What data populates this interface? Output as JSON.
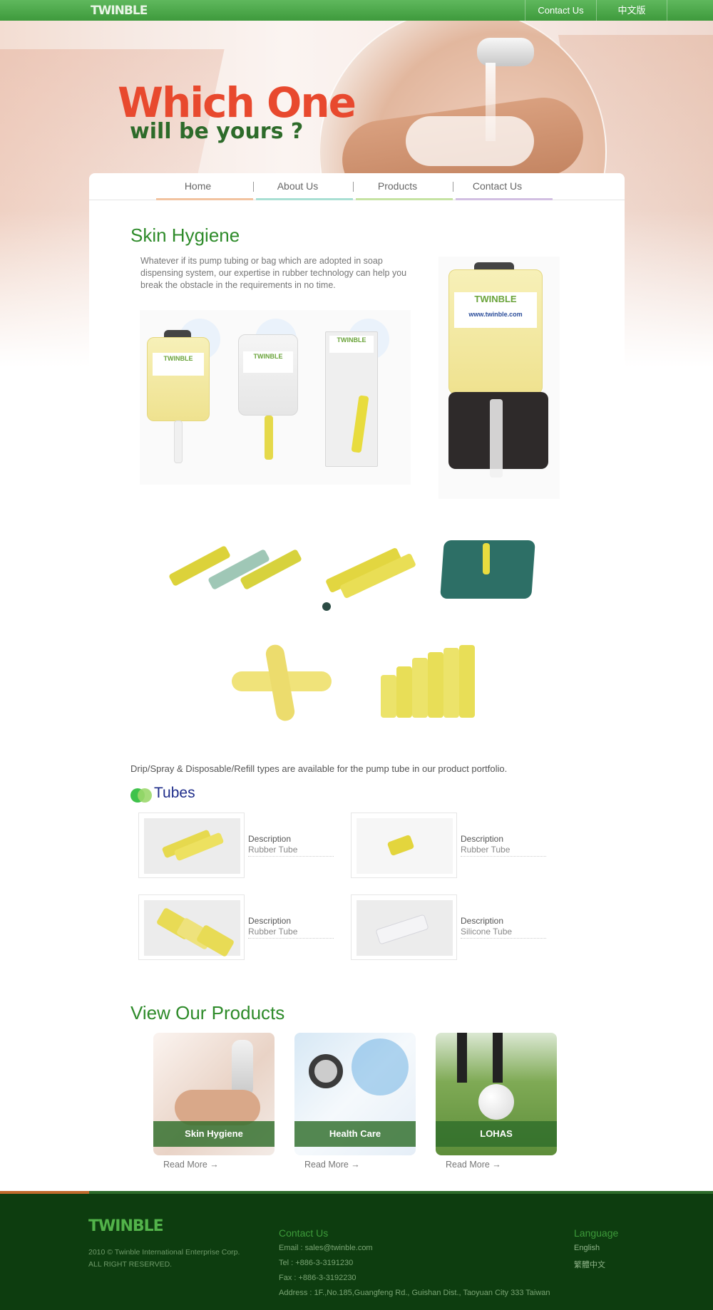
{
  "topbar": {
    "logo": "TWINBLE",
    "contact_label": "Contact Us",
    "chinese_label": "中文版"
  },
  "hero": {
    "title": "Which One",
    "subtitle": "will be yours ?"
  },
  "nav": {
    "items": [
      {
        "label": "Home",
        "color": "#f2c3a0"
      },
      {
        "label": "About Us",
        "color": "#a9dfd3"
      },
      {
        "label": "Products",
        "color": "#c6e3a3"
      },
      {
        "label": "Contact Us",
        "color": "#d2bfe2"
      }
    ]
  },
  "skin": {
    "title": "Skin Hygiene",
    "intro": "Whatever if its pump tubing or bag which are adopted in soap dispensing system, our expertise in rubber technology can help you break the obstacle in the requirements in no time.",
    "bottle_label": "TWINBLE",
    "bottle_url": "www.twinble.com"
  },
  "note": "Drip/Spray & Disposable/Refill types are available for the pump tube in our product portfolio.",
  "tubes": {
    "title": "Tubes",
    "items": [
      {
        "desc_title": "Description",
        "desc_value": "Rubber Tube"
      },
      {
        "desc_title": "Description",
        "desc_value": "Rubber Tube"
      },
      {
        "desc_title": "Description",
        "desc_value": "Rubber Tube"
      },
      {
        "desc_title": "Description",
        "desc_value": "Silicone Tube"
      }
    ]
  },
  "products": {
    "title": "View Our Products",
    "items": [
      {
        "label": "Skin Hygiene",
        "read_more": "Read More →"
      },
      {
        "label": "Health Care",
        "read_more": "Read More →"
      },
      {
        "label": "LOHAS",
        "read_more": "Read More →"
      }
    ]
  },
  "footer": {
    "logo": "TWINBLE",
    "copyright": "2010 © Twinble International Enterprise Corp.",
    "rights": "ALL RIGHT RESERVED.",
    "contact_head": "Contact Us",
    "email": "Email : sales@twinble.com",
    "tel": "Tel : +886-3-3191230",
    "fax": "Fax : +886-3-3192230",
    "address": "Address : 1F.,No.185,Guangfeng Rd., Guishan Dist., Taoyuan City 333 Taiwan",
    "language_head": "Language",
    "lang_english": "English",
    "lang_chinese": "繁體中文"
  }
}
